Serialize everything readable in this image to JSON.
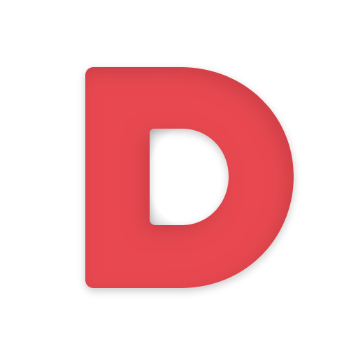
{
  "logo": {
    "letter": "D",
    "icon_name": "letter-d-logo-icon",
    "colors": {
      "primary": "#E84A51",
      "shadow": "#B93740",
      "background": "#FFFFFF",
      "hole": "#FFFFFF"
    }
  }
}
